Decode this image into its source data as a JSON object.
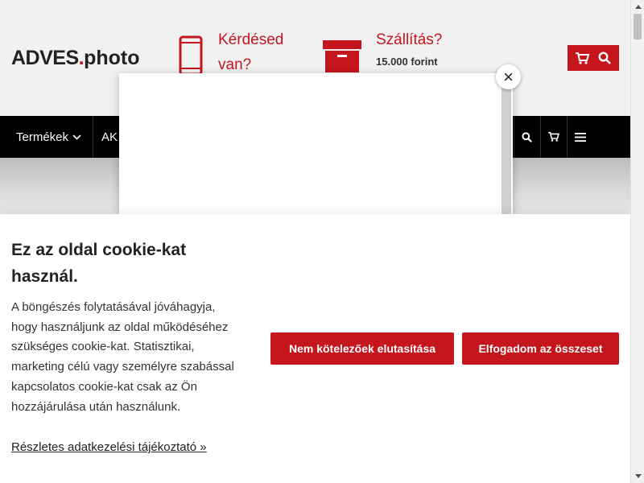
{
  "header": {
    "logo_main": "ADVES",
    "logo_dot": ".",
    "logo_sub": "photo",
    "contact_label": "Kérdésed van?",
    "shipping_label": "Szállítás?",
    "shipping_value": "15.000 forint"
  },
  "nav": {
    "products_label": "Termékek",
    "akc_label": "AK"
  },
  "cookie": {
    "title": "Ez az oldal cookie-kat használ.",
    "text": "A böngészés folytatásával jóváhagyja, hogy használjunk az oldal működéséhez szükséges cookie-kat. Statisztikai, marketing célú vagy személyre szabással kapcsolatos cookie-kat csak az Ön hozzájárulása után használunk.",
    "link": "Részletes adatkezelési tájékoztató »",
    "reject_label": "Nem kötelezőek elutasítása",
    "accept_label": "Elfogadom az összeset"
  },
  "popup": {
    "close_symbol": "×"
  },
  "colors": {
    "brand_red": "#c4161c",
    "nav_bg": "#000000",
    "page_bg": "#f1f1f1"
  },
  "icons": [
    "phone-icon",
    "box-icon",
    "cart-icon",
    "search-icon",
    "chevron-down-icon",
    "menu-icon",
    "close-icon"
  ]
}
